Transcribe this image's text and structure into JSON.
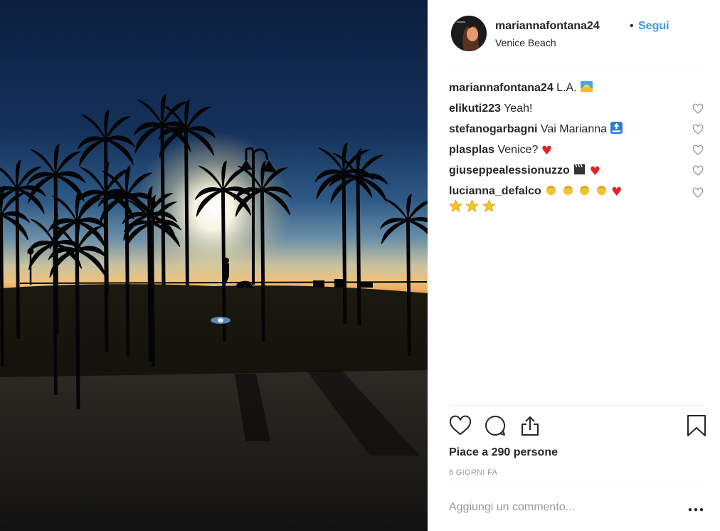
{
  "post": {
    "username": "mariannafontana24",
    "separator": "•",
    "follow_label": "Segui",
    "location": "Venice Beach",
    "avatar_icon": "profile-photo",
    "image_description_icon": "photo-sunset-palms"
  },
  "comments": [
    {
      "user": "mariannafontana24",
      "text": "L.A.",
      "emojis": [
        "sunrise-emoji"
      ],
      "has_like": false
    },
    {
      "user": "elikuti223",
      "text": "Yeah!",
      "emojis": [],
      "has_like": true
    },
    {
      "user": "stefanogarbagni",
      "text": "Vai Marianna",
      "emojis": [
        "top-arrow-emoji"
      ],
      "has_like": true
    },
    {
      "user": "plasplas",
      "text": "Venice?",
      "emojis": [
        "heart-emoji"
      ],
      "has_like": true
    },
    {
      "user": "giuseppealessionuzzo",
      "text": "",
      "emojis": [
        "clapper-board-emoji",
        "heart-emoji"
      ],
      "has_like": true
    },
    {
      "user": "lucianna_defalco",
      "text": "",
      "emojis": [
        "clapping-hands-emoji",
        "clapping-hands-emoji",
        "clapping-hands-emoji",
        "clapping-hands-emoji",
        "heart-emoji",
        "star-emoji",
        "star-emoji",
        "star-emoji"
      ],
      "has_like": true
    }
  ],
  "actions": {
    "like_icon": "heart-outline-icon",
    "comment_icon": "comment-bubble-icon",
    "share_icon": "share-upload-icon",
    "save_icon": "bookmark-icon"
  },
  "likes_text": "Piace a 290 persone",
  "time_ago": "6 GIORNI FA",
  "add_comment_placeholder": "Aggiungi un commento...",
  "colors": {
    "link_blue": "#3897f0",
    "text": "#262626",
    "muted": "#999999",
    "divider": "#efefef",
    "heart_red": "#e3242b"
  }
}
